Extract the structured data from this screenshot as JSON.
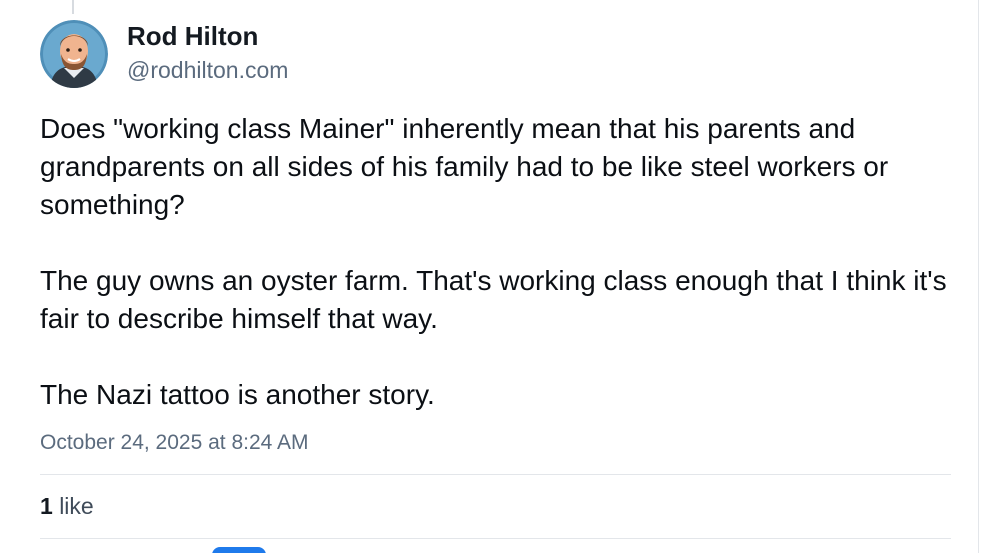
{
  "author": {
    "name": "Rod Hilton",
    "handle": "@rodhilton.com",
    "avatar_icon": "user-avatar-icon"
  },
  "post": {
    "paragraphs": [
      "Does \"working class Mainer\" inherently mean that his parents and grandparents on all sides of his family had to be like steel workers or something?",
      "The guy owns an oyster farm. That's working class enough that I think it's fair to describe himself that way.",
      "The Nazi tattoo is another story."
    ],
    "timestamp": "October 24, 2025 at 8:24 AM"
  },
  "engagement": {
    "like_count": "1",
    "like_label": "like"
  },
  "colors": {
    "text_primary": "#0b0f14",
    "text_secondary": "#5b6b7e",
    "divider": "#e3e6ea",
    "accent": "#1f7aeb"
  }
}
